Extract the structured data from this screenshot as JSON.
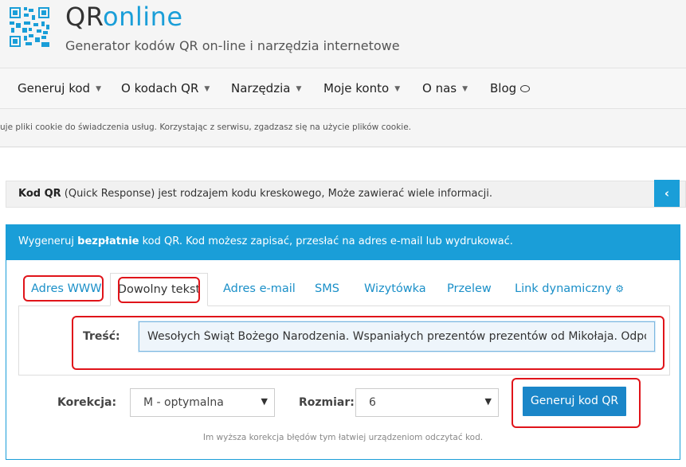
{
  "header": {
    "brand_main": "QR",
    "brand_accent": "online",
    "tagline": "Generator kodów QR on-line i narzędzia internetowe"
  },
  "nav": {
    "items": [
      {
        "label": "Generuj kod"
      },
      {
        "label": "O kodach QR"
      },
      {
        "label": "Narzędzia"
      },
      {
        "label": "Moje konto"
      },
      {
        "label": "O nas"
      },
      {
        "label": "Blog"
      }
    ]
  },
  "cookie_notice": "uje pliki cookie do świadczenia usług. Korzystając z serwisu, zgadzasz się na użycie plików cookie.",
  "info_bar": {
    "bold": "Kod QR",
    "text": " (Quick Response) jest rodzajem kodu kreskowego, Może zawierać wiele informacji.",
    "toggle": "‹"
  },
  "panel": {
    "head_pre": "Wygeneruj ",
    "head_bold": "bezpłatnie",
    "head_post": " kod QR. Kod możesz zapisać, przesłać na adres e-mail lub wydrukować.",
    "tabs": [
      {
        "label": "Adres WWW"
      },
      {
        "label": "Dowolny tekst"
      },
      {
        "label": "Adres e-mail"
      },
      {
        "label": "SMS"
      },
      {
        "label": "Wizytówka"
      },
      {
        "label": "Przelew"
      },
      {
        "label": "Link dynamiczny"
      }
    ],
    "content_label": "Treść:",
    "content_value": "Wesołych Świąt Bożego Narodzenia. Wspaniałych prezentów prezentów od Mikołaja. Odpocznijcie",
    "correction_label": "Korekcja:",
    "correction_value": "M - optymalna",
    "size_label": "Rozmiar:",
    "size_value": "6",
    "generate_button": "Generuj kod QR",
    "hint": "Im wyższa korekcja błędów tym łatwiej urządzeniom odczytać kod."
  },
  "colors": {
    "accent": "#1a9ed8",
    "highlight": "#e0141a"
  }
}
